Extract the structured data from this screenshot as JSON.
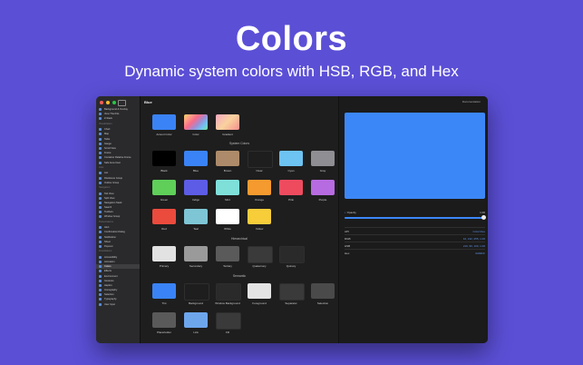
{
  "hero": {
    "title": "Colors",
    "subtitle": "Dynamic system colors with HSB, RGB, and Hex"
  },
  "window": {
    "title": "Blue",
    "documentation_label": "Documentation",
    "traffic_colors": [
      "#ff5f57",
      "#febc2e",
      "#28c840"
    ]
  },
  "sidebar": {
    "groups": [
      {
        "section": "",
        "items": [
          "Background & Overlay",
          "View That Fits",
          "Z-Stack"
        ]
      },
      {
        "section": "Visualization",
        "items": [
          "Chart",
          "Map",
          "Table",
          "Gauge",
          "Scroll View",
          "Frame",
          "Container Relative Frame",
          "Safe Area Inset"
        ]
      },
      {
        "section": "Lists",
        "items": [
          "List",
          "Disclosure Group",
          "Outline Group"
        ]
      },
      {
        "section": "Navigation",
        "items": [
          "Tab View",
          "Split View",
          "Navigation Stack",
          "Search",
          "Toolbars",
          "Window Group"
        ]
      },
      {
        "section": "Presentations",
        "items": [
          "Alert",
          "Confirmation Dialog",
          "Notification",
          "Sheet",
          "Popover"
        ]
      },
      {
        "section": "Foundations",
        "items": [
          "Accessibility",
          "Animation",
          "Colors",
          "Effects",
          "Environment",
          "Gestures",
          "Haptics",
          "Iconography",
          "Selection",
          "Typography",
          "User Input"
        ]
      }
    ],
    "selected_item": "Colors"
  },
  "main": {
    "top_swatches": [
      {
        "label": "Accent Color",
        "color": "#3a83f6"
      },
      {
        "label": "Color",
        "color": "gradient-rainbow"
      },
      {
        "label": "Gradient",
        "color": "gradient-warm"
      }
    ],
    "system_section_title": "System Colors",
    "system_colors": [
      {
        "label": "Black",
        "color": "#000000"
      },
      {
        "label": "Blue",
        "color": "#3a83f6"
      },
      {
        "label": "Brown",
        "color": "#ad8b6a"
      },
      {
        "label": "Clear",
        "color": "#1e1e1e"
      },
      {
        "label": "Cyan",
        "color": "#6dc3f2"
      },
      {
        "label": "Gray",
        "color": "#8e8e93"
      },
      {
        "label": "Green",
        "color": "#5fcf5a"
      },
      {
        "label": "Indigo",
        "color": "#5d5ce6"
      },
      {
        "label": "Mint",
        "color": "#7fe0da"
      },
      {
        "label": "Orange",
        "color": "#f59a2e"
      },
      {
        "label": "Pink",
        "color": "#ef4b5f"
      },
      {
        "label": "Purple",
        "color": "#b76be0"
      },
      {
        "label": "Red",
        "color": "#eb4b3d"
      },
      {
        "label": "Teal",
        "color": "#7ec6d6"
      },
      {
        "label": "White",
        "color": "#ffffff"
      },
      {
        "label": "Yellow",
        "color": "#f7cd3a"
      }
    ],
    "hierarchical_section_title": "Hierarchical",
    "hierarchical_colors": [
      {
        "label": "Primary",
        "color": "#e2e2e2"
      },
      {
        "label": "Secondary",
        "color": "#9a9a9a"
      },
      {
        "label": "Tertiary",
        "color": "#5a5a5a"
      },
      {
        "label": "Quaternary",
        "color": "#3a3a3a"
      },
      {
        "label": "Quinary",
        "color": "#2a2a2a"
      }
    ],
    "semantic_section_title": "Semantic",
    "semantic_colors": [
      {
        "label": "Tint",
        "color": "#3a83f6"
      },
      {
        "label": "Background",
        "color": "#1e1e1e"
      },
      {
        "label": "Window Background",
        "color": "#2a2a2a"
      },
      {
        "label": "Foreground",
        "color": "#e4e4e4"
      },
      {
        "label": "Separator",
        "color": "#3a3a3a"
      },
      {
        "label": "Selection",
        "color": "#4a4a4a"
      },
      {
        "label": "Placeholder",
        "color": "#5a5a5a"
      },
      {
        "label": "Link",
        "color": "#6ea6ec"
      },
      {
        "label": "Fill",
        "color": "#3a3a3a"
      }
    ]
  },
  "detail": {
    "preview_color": "#3c87f8",
    "opacity_label": "Opacity",
    "opacity_value": "1.00",
    "opacity_level": 1.0,
    "rows": [
      {
        "key": "API",
        "value": "Color.blue"
      },
      {
        "key": "RGB",
        "value": "10, 132, 255, 1.00"
      },
      {
        "key": "HSB",
        "value": "210, 96, 100, 1.00"
      },
      {
        "key": "Hex",
        "value": "0A84FF"
      }
    ]
  }
}
